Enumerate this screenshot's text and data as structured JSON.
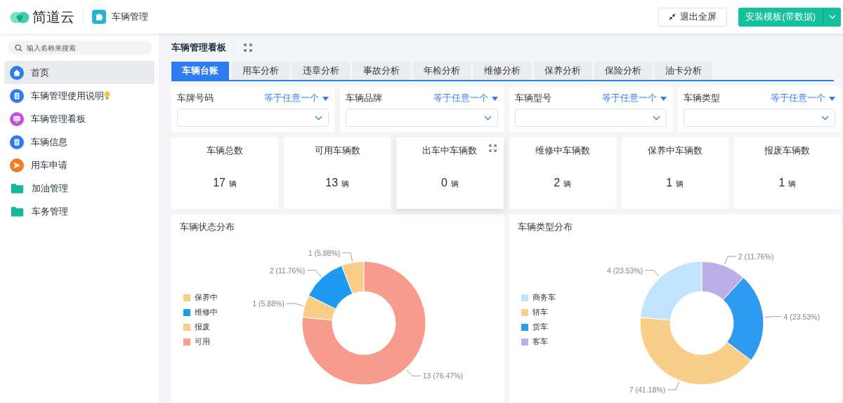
{
  "header": {
    "brand": "简道云",
    "app_name": "车辆管理",
    "buttons": [
      {
        "kind": "outline",
        "label": "退出全屏"
      },
      {
        "kind": "primary",
        "label": "安装模板(带数据)"
      }
    ]
  },
  "sidebar": {
    "search": {
      "placeholder": "输入名称来搜索"
    },
    "items": [
      {
        "label": "首页",
        "kind": "home",
        "selected": true
      },
      {
        "label": "车辆管理使用说明",
        "kind": "doc",
        "selected": false,
        "hint": true
      },
      {
        "label": "车辆管理看板",
        "kind": "dashboard",
        "selected": false
      },
      {
        "label": "车辆信息",
        "kind": "doc",
        "selected": false
      },
      {
        "label": "用车申请",
        "kind": "send",
        "selected": false
      },
      {
        "label": "加油管理",
        "kind": "folder",
        "selected": false
      },
      {
        "label": "车务管理",
        "kind": "folder",
        "selected": false
      }
    ]
  },
  "dashboard": {
    "title": "车辆管理看板",
    "tabs": [
      {
        "label": "车辆台账",
        "selected": true
      },
      {
        "label": "用车分析",
        "selected": false
      },
      {
        "label": "违章分析",
        "selected": false
      },
      {
        "label": "事故分析",
        "selected": false
      },
      {
        "label": "年检分析",
        "selected": false
      },
      {
        "label": "维修分析",
        "selected": false
      },
      {
        "label": "保养分析",
        "selected": false
      },
      {
        "label": "保险分析",
        "selected": false
      },
      {
        "label": "油卡分析",
        "selected": false
      }
    ],
    "filters": [
      {
        "label": "车牌号码",
        "operator": "等于任意一个"
      },
      {
        "label": "车辆品牌",
        "operator": "等于任意一个"
      },
      {
        "label": "车辆型号",
        "operator": "等于任意一个"
      },
      {
        "label": "车辆类型",
        "operator": "等于任意一个"
      }
    ],
    "stats": [
      {
        "label": "车辆总数",
        "value": "17",
        "unit": "辆",
        "highlighted": false
      },
      {
        "label": "可用车辆数",
        "value": "13",
        "unit": "辆",
        "highlighted": false
      },
      {
        "label": "出车中车辆数",
        "value": "0",
        "unit": "辆",
        "highlighted": true
      },
      {
        "label": "维修中车辆数",
        "value": "2",
        "unit": "辆",
        "highlighted": false
      },
      {
        "label": "保养中车辆数",
        "value": "1",
        "unit": "辆",
        "highlighted": false
      },
      {
        "label": "报废车辆数",
        "value": "1",
        "unit": "辆",
        "highlighted": false
      }
    ],
    "charts": [
      {
        "title": "车辆状态分布",
        "legend": [
          {
            "label": "保养中",
            "color": "#f9cd86"
          },
          {
            "label": "维修中",
            "color": "#1e9af3"
          },
          {
            "label": "报废",
            "color": "#f9cd86"
          },
          {
            "label": "可用",
            "color": "#f79b8c"
          }
        ],
        "chart_data": {
          "type": "donut",
          "values": [
            1,
            2,
            1,
            13
          ],
          "value_labels": [
            "1 (5.88%)",
            "2 (11.76%)",
            "1 (5.88%)",
            "13 (76.47%)"
          ]
        }
      },
      {
        "title": "车辆类型分布",
        "legend": [
          {
            "label": "商务车",
            "color": "#c1e3fd"
          },
          {
            "label": "轿车",
            "color": "#f9ce88"
          },
          {
            "label": "货车",
            "color": "#2e9bf0"
          },
          {
            "label": "客车",
            "color": "#bcaee6"
          }
        ],
        "chart_data": {
          "type": "donut",
          "values": [
            4,
            7,
            4,
            2
          ],
          "value_labels": [
            "4 (23.53%)",
            "7 (41.18%)",
            "4 (23.53%)",
            "2 (11.76%)"
          ]
        }
      }
    ]
  }
}
